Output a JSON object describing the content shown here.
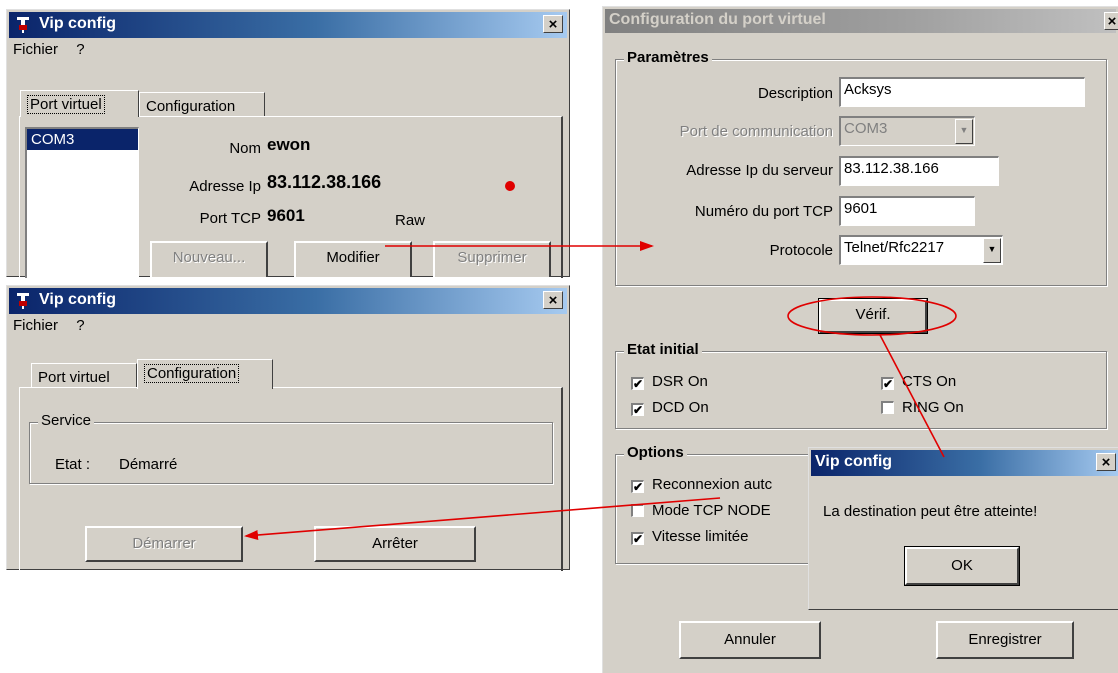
{
  "win1": {
    "title": "Vip config",
    "menu": [
      "Fichier",
      "?"
    ],
    "tabs": [
      "Port virtuel",
      "Configuration"
    ],
    "list": [
      "COM3"
    ],
    "nom_label": "Nom",
    "nom_value": "ewon",
    "ip_label": "Adresse Ip",
    "ip_value": "83.112.38.166",
    "port_label": "Port TCP",
    "port_value": "9601",
    "mode": "Raw",
    "status_color": "#e00000",
    "buttons": {
      "nouveau": "Nouveau...",
      "modifier": "Modifier",
      "supprimer": "Supprimer"
    },
    "close": "×"
  },
  "win2": {
    "title": "Vip config",
    "menu": [
      "Fichier",
      "?"
    ],
    "tabs": [
      "Port virtuel",
      "Configuration"
    ],
    "service_label": "Service",
    "etat_label": "Etat :",
    "etat_value": "Démarré",
    "buttons": {
      "demarrer": "Démarrer",
      "arreter": "Arrêter"
    },
    "close": "×"
  },
  "win3": {
    "title": "Configuration du port virtuel",
    "close": "×",
    "params": {
      "legend": "Paramètres",
      "description_label": "Description",
      "description_value": "Acksys",
      "comport_label": "Port de communication",
      "comport_value": "COM3",
      "ip_label": "Adresse Ip du serveur",
      "ip_value": "83.112.38.166",
      "port_label": "Numéro du port TCP",
      "port_value": "9601",
      "protocole_label": "Protocole",
      "protocole_value": "Telnet/Rfc2217"
    },
    "verif": "Vérif.",
    "etat": {
      "legend": "Etat initial",
      "dsr": "DSR On",
      "dsr_checked": true,
      "dcd": "DCD On",
      "dcd_checked": true,
      "cts": "CTS On",
      "cts_checked": true,
      "ring": "RING On",
      "ring_checked": false
    },
    "options": {
      "legend": "Options",
      "reconnexion": "Reconnexion autc",
      "reconnexion_checked": true,
      "nodelay": "Mode TCP NODE",
      "nodelay_checked": false,
      "vitesse": "Vitesse limitée",
      "vitesse_checked": true
    },
    "buttons": {
      "annuler": "Annuler",
      "enregistrer": "Enregistrer"
    }
  },
  "dialog": {
    "title": "Vip config",
    "message": "La destination peut être atteinte!",
    "ok": "OK",
    "close": "×"
  },
  "check_mark": "✔",
  "dropdown_arrow": "▼",
  "annotation_color": "#e00000"
}
